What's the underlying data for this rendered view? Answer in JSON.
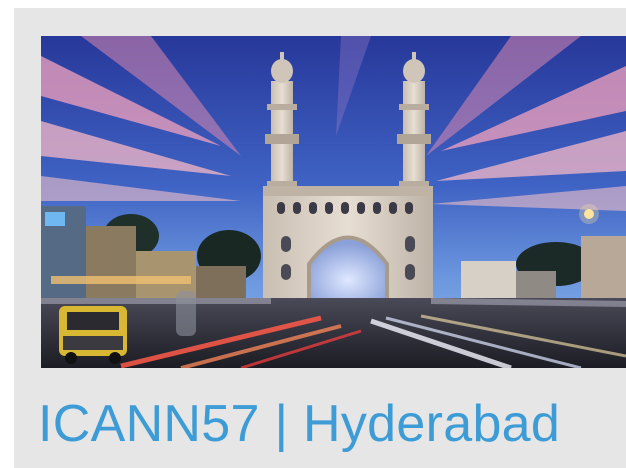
{
  "card": {
    "caption": "ICANN57 | Hyderabad"
  },
  "colors": {
    "caption_color": "#3d9bd6",
    "card_background": "#e6e6e6",
    "sky_top": "#2a3f9e",
    "sky_bottom": "#5c8fd6",
    "streak_pink": "#f08aa8",
    "monument_stone": "#d8cfc4"
  },
  "photo": {
    "subject": "charminar-monument-photo"
  }
}
